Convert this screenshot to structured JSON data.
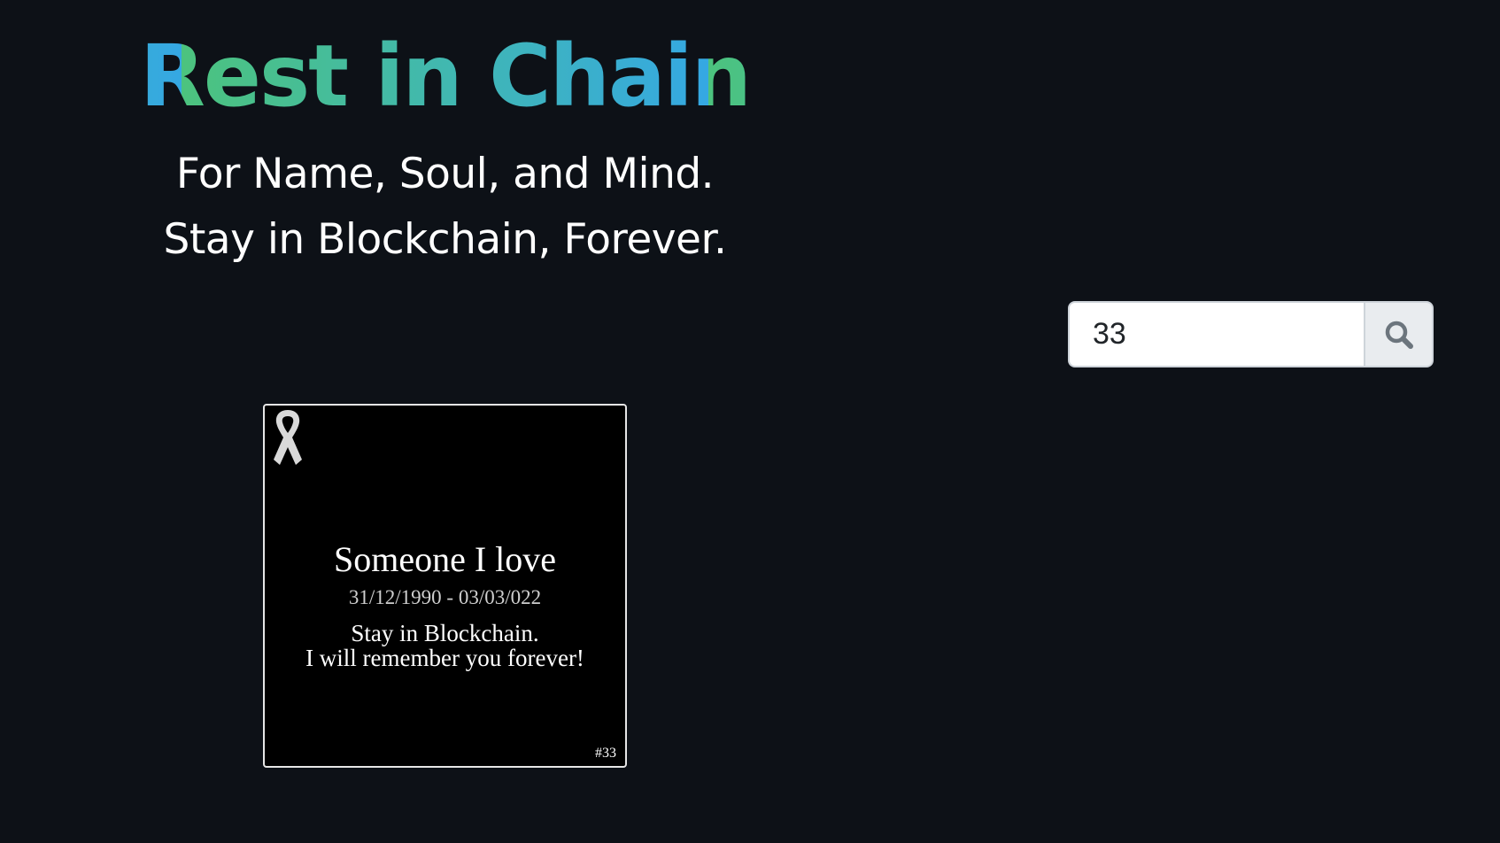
{
  "hero": {
    "title": "Rest in Chain",
    "tagline_line1": "For Name, Soul, and Mind.",
    "tagline_line2": "Stay in Blockchain, Forever."
  },
  "search": {
    "value": "33",
    "button_icon": "search-icon"
  },
  "memorial_card": {
    "icon": "ribbon-icon",
    "name": "Someone I love",
    "dates": "31/12/1990 - 03/03/022",
    "message_line1": "Stay in Blockchain.",
    "message_line2": "I will remember you forever!",
    "token_id": "#33"
  },
  "colors": {
    "background": "#0d1117",
    "title_gradient_start": "#4cc37e",
    "title_gradient_end": "#35a8e3",
    "card_background": "#000000"
  }
}
